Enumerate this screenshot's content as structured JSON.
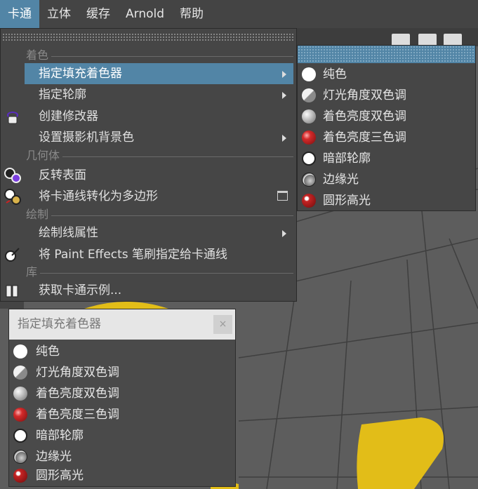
{
  "menubar": {
    "items": [
      {
        "label": "卡通",
        "active": true
      },
      {
        "label": "立体"
      },
      {
        "label": "缓存"
      },
      {
        "label": "Arnold"
      },
      {
        "label": "帮助"
      }
    ]
  },
  "main_menu": {
    "sections": [
      {
        "title": "着色"
      },
      {
        "title": "几何体"
      },
      {
        "title": "绘制"
      },
      {
        "title": "库"
      }
    ],
    "items": [
      {
        "label": "指定填充着色器",
        "submenu": true,
        "highlighted": true
      },
      {
        "label": "指定轮廓",
        "submenu": true
      },
      {
        "label": "创建修改器"
      },
      {
        "label": "设置摄影机背景色",
        "submenu": true
      },
      {
        "label": "反转表面"
      },
      {
        "label": "将卡通线转化为多边形",
        "option_box": true
      },
      {
        "label": "绘制线属性",
        "submenu": true
      },
      {
        "label": "将 Paint Effects 笔刷指定给卡通线"
      },
      {
        "label": "获取卡通示例..."
      }
    ]
  },
  "submenu": {
    "items": [
      {
        "label": "纯色",
        "icon": "solid-color-shader-icon"
      },
      {
        "label": "灯光角度双色调",
        "icon": "light-angle-two-tone-icon"
      },
      {
        "label": "着色亮度双色调",
        "icon": "shaded-brightness-two-tone-icon"
      },
      {
        "label": "着色亮度三色调",
        "icon": "shaded-brightness-three-tone-icon"
      },
      {
        "label": "暗部轮廓",
        "icon": "dark-profile-icon"
      },
      {
        "label": "边缘光",
        "icon": "rim-light-icon"
      },
      {
        "label": "圆形高光",
        "icon": "circle-highlights-icon"
      }
    ]
  },
  "panel": {
    "title": "指定填充着色器",
    "close_label": "×",
    "items": [
      {
        "label": "纯色"
      },
      {
        "label": "灯光角度双色调"
      },
      {
        "label": "着色亮度双色调"
      },
      {
        "label": "着色亮度三色调"
      },
      {
        "label": "暗部轮廓"
      },
      {
        "label": "边缘光"
      },
      {
        "label": "圆形高光"
      }
    ]
  },
  "colors": {
    "accent": "#5285a6",
    "menu_bg": "#464646",
    "object_yellow": "#e8c21c"
  }
}
